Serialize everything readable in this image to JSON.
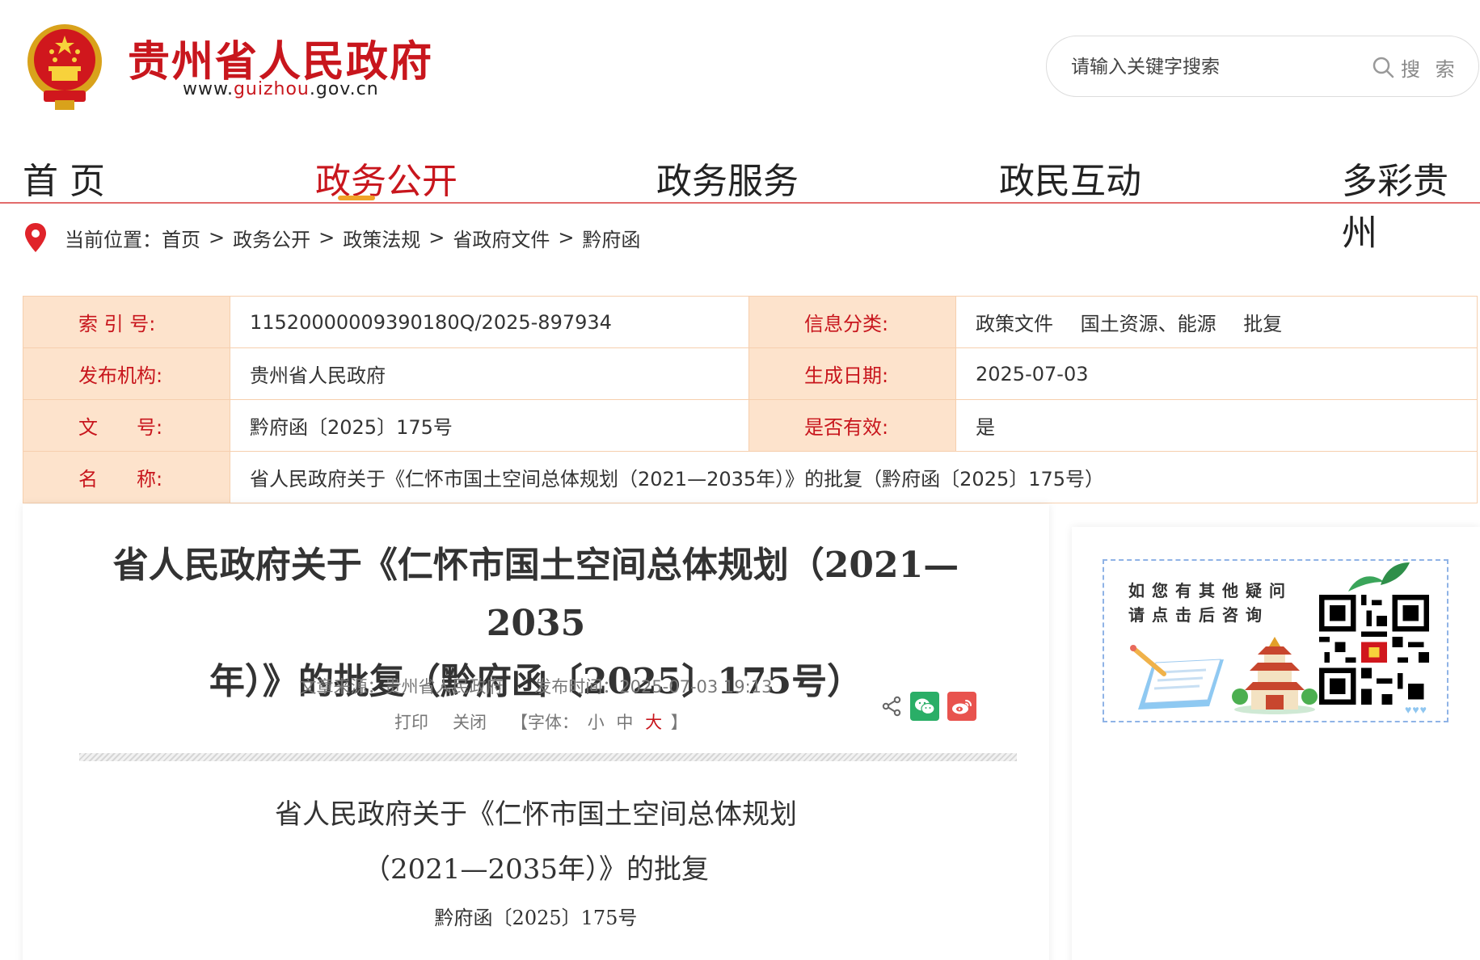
{
  "site": {
    "name": "贵州省人民政府",
    "url_prefix": "www.",
    "url_highlight": "guizhou",
    "url_suffix": ".gov.cn",
    "brand_color": "#c8161d"
  },
  "search": {
    "placeholder": "请输入关键字搜索",
    "button_label": "搜 索"
  },
  "nav": {
    "items": [
      "首 页",
      "政务公开",
      "政务服务",
      "政民互动",
      "多彩贵州"
    ],
    "active_index": 1
  },
  "breadcrumb": {
    "prefix": "当前位置：",
    "items": [
      "首页",
      "政务公开",
      "政策法规",
      "省政府文件",
      "黔府函"
    ],
    "separator": ">"
  },
  "info": {
    "index_label": "索 引 号:",
    "index_value": "11520000009390180Q/2025-897934",
    "category_label": "信息分类:",
    "category_values": [
      "政策文件",
      "国土资源、能源",
      "批复"
    ],
    "publisher_label": "发布机构:",
    "publisher_value": "贵州省人民政府",
    "date_label": "生成日期:",
    "date_value": "2025-07-03",
    "docno_label": "文　　号:",
    "docno_value": "黔府函〔2025〕175号",
    "valid_label": "是否有效:",
    "valid_value": "是",
    "name_label": "名　　称:",
    "name_value": "省人民政府关于《仁怀市国土空间总体规划（2021—2035年）》的批复（黔府函〔2025〕175号）"
  },
  "article": {
    "title_line1": "省人民政府关于《仁怀市国土空间总体规划（2021—2035",
    "title_line2": "年）》的批复（黔府函〔2025〕175号）",
    "source": "文章来源：贵州省人民政府",
    "publish_time": "发布时间：2025-07-03 19:13",
    "print_label": "打印",
    "close_label": "关闭",
    "font_prefix": "【字体：",
    "font_small": "小",
    "font_medium": "中",
    "font_large": "大",
    "font_suffix": "】",
    "doc_title_line1": "省人民政府关于《仁怀市国土空间总体规划",
    "doc_title_line2": "（2021—2035年）》的批复",
    "doc_number": "黔府函〔2025〕175号"
  },
  "consult": {
    "line1": "如您有其他疑问",
    "line2": "请点击后咨询"
  },
  "icons": [
    "national-emblem-icon",
    "search-icon",
    "location-pin-icon",
    "share-icon",
    "wechat-icon",
    "weibo-icon",
    "qr-code-icon"
  ]
}
